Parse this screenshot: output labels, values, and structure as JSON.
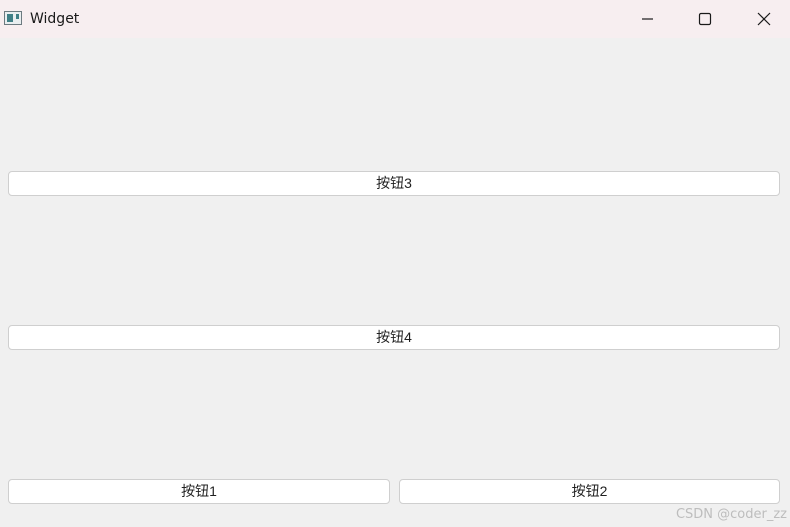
{
  "window": {
    "title": "Widget",
    "icons": {
      "app": "app-window-icon",
      "minimize": "minimize-icon",
      "maximize": "maximize-icon",
      "close": "close-icon"
    }
  },
  "buttons": {
    "button3": "按钮3",
    "button4": "按钮4",
    "button1": "按钮1",
    "button2": "按钮2"
  },
  "watermark": "CSDN @coder_zz",
  "colors": {
    "titlebar_bg": "#f7eef0",
    "window_bg": "#f0f0f0",
    "button_bg": "#ffffff",
    "button_border": "#cfcfcf"
  }
}
